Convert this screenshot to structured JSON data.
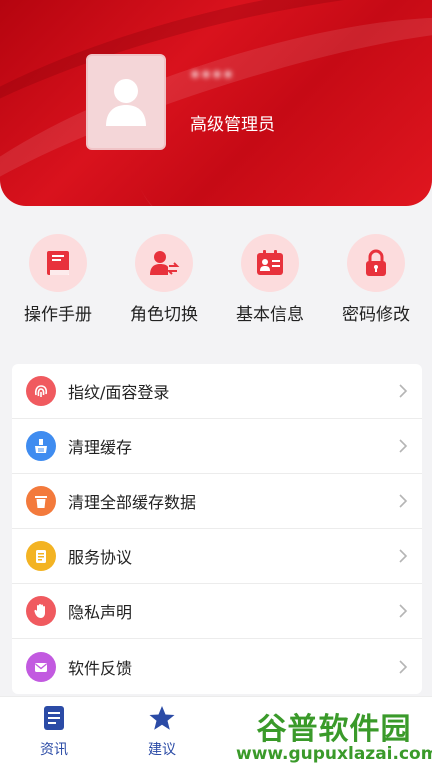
{
  "profile": {
    "name": "****",
    "role": "高级管理员"
  },
  "quick_actions": [
    {
      "label": "操作手册",
      "icon": "book-icon"
    },
    {
      "label": "角色切换",
      "icon": "user-switch-icon"
    },
    {
      "label": "基本信息",
      "icon": "id-card-icon"
    },
    {
      "label": "密码修改",
      "icon": "lock-icon"
    }
  ],
  "menu": [
    {
      "label": "指纹/面容登录",
      "icon": "fingerprint-icon",
      "color": "#f05a5f"
    },
    {
      "label": "清理缓存",
      "icon": "broom-icon",
      "color": "#3f8cf0"
    },
    {
      "label": "清理全部缓存数据",
      "icon": "trash-icon",
      "color": "#f37a3c"
    },
    {
      "label": "服务协议",
      "icon": "document-icon",
      "color": "#f3b323"
    },
    {
      "label": "隐私声明",
      "icon": "hand-icon",
      "color": "#f05a5f"
    },
    {
      "label": "软件反馈",
      "icon": "mail-icon",
      "color": "#c25ae0"
    }
  ],
  "tabs": [
    {
      "label": "资讯",
      "icon": "news-icon"
    },
    {
      "label": "建议",
      "icon": "star-icon"
    }
  ],
  "watermark": {
    "title": "谷普软件园",
    "url": "www.gupuxlazai.com"
  },
  "colors": {
    "brand_red": "#d9121d",
    "tab_active": "#2b4ba6"
  }
}
